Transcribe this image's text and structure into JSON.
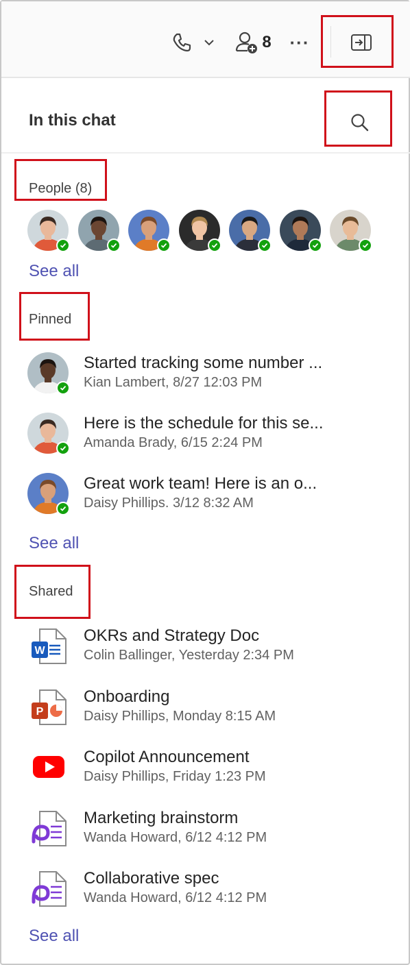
{
  "topbar": {
    "participants_count": "8",
    "more_label": "···"
  },
  "panel": {
    "title": "In this chat"
  },
  "people": {
    "title": "People (8)",
    "see_all": "See all",
    "avatars": [
      {
        "skin": "#e9b89a",
        "hair": "#3a2a22",
        "bg": "#cfd8dc",
        "shirt": "#e05a3a"
      },
      {
        "skin": "#6b4632",
        "hair": "#1c1410",
        "bg": "#90a4ae",
        "shirt": "#5d6b73"
      },
      {
        "skin": "#d9a07a",
        "hair": "#7a4a2a",
        "bg": "#5b7fc7",
        "shirt": "#e07a28"
      },
      {
        "skin": "#f0c4a4",
        "hair": "#b08850",
        "bg": "#2b2b2b",
        "shirt": "#3a3a3a"
      },
      {
        "skin": "#d8a882",
        "hair": "#1a1a1a",
        "bg": "#4a6da8",
        "shirt": "#2b2f3a"
      },
      {
        "skin": "#b07a58",
        "hair": "#1c1410",
        "bg": "#3a4a5a",
        "shirt": "#1e2a3a"
      },
      {
        "skin": "#e8bb98",
        "hair": "#6a4a2a",
        "bg": "#d8d4cc",
        "shirt": "#6c8a6a"
      }
    ]
  },
  "pinned": {
    "title": "Pinned",
    "see_all": "See all",
    "items": [
      {
        "text": "Started tracking some number ...",
        "meta": "Kian Lambert, 8/27 12:03 PM"
      },
      {
        "text": "Here is the schedule for this se...",
        "meta": "Amanda Brady, 6/15 2:24 PM"
      },
      {
        "text": "Great work team! Here is an o...",
        "meta": "Daisy Phillips. 3/12 8:32 AM"
      }
    ]
  },
  "shared": {
    "title": "Shared",
    "see_all": "See all",
    "items": [
      {
        "name": "OKRs and Strategy Doc",
        "meta": "Colin Ballinger, Yesterday 2:34 PM",
        "icon": "word-doc-icon"
      },
      {
        "name": "Onboarding",
        "meta": "Daisy Phillips, Monday 8:15 AM",
        "icon": "powerpoint-icon"
      },
      {
        "name": "Copilot Announcement",
        "meta": "Daisy Phillips, Friday 1:23 PM",
        "icon": "youtube-icon"
      },
      {
        "name": "Marketing brainstorm",
        "meta": "Wanda Howard,  6/12 4:12 PM",
        "icon": "loop-page-icon"
      },
      {
        "name": "Collaborative spec",
        "meta": "Wanda Howard,  6/12 4:12 PM",
        "icon": "loop-page-icon"
      }
    ]
  },
  "colors": {
    "accent": "#4f52b2",
    "presence": "#13a10e",
    "annotation": "#d0101a"
  }
}
